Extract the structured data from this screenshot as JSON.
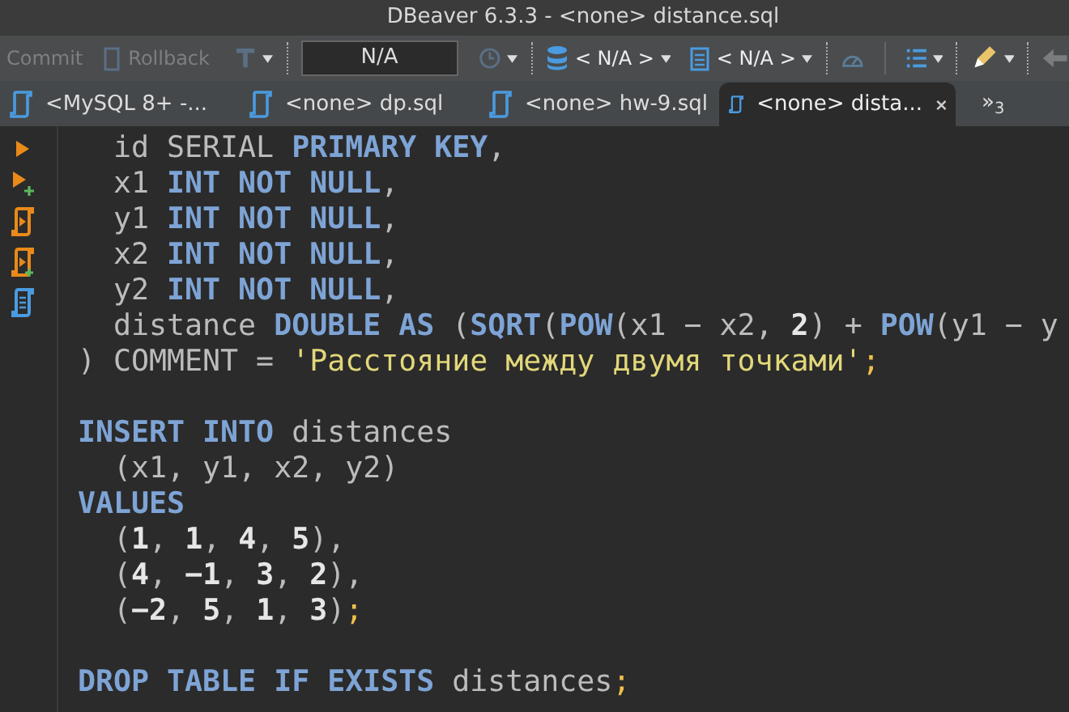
{
  "window": {
    "title": "DBeaver 6.3.3 - <none> distance.sql"
  },
  "toolbar": {
    "commit": {
      "label": "Commit",
      "disabled": true
    },
    "rollback": {
      "label": "Rollback",
      "disabled": true
    },
    "transaction_field": {
      "value": "N/A"
    },
    "datasource": {
      "label": "< N/A >"
    },
    "schema": {
      "label": "< N/A >"
    }
  },
  "tabs": [
    {
      "label": "<MySQL 8+ -...",
      "selected": false
    },
    {
      "label": "<none> dp.sql",
      "selected": false
    },
    {
      "label": "<none> hw-9.sql",
      "selected": false
    },
    {
      "label": "<none> dista...",
      "selected": true
    }
  ],
  "tab_overflow": "»$_{3}$",
  "editor": {
    "blocks": [
      [
        [
          {
            "kind": "plain",
            "text": "  id SERIAL "
          },
          {
            "kind": "kw",
            "text": "PRIMARY KEY"
          },
          {
            "kind": "plain",
            "text": ","
          }
        ],
        [
          {
            "kind": "plain",
            "text": "  x1 "
          },
          {
            "kind": "kw",
            "text": "INT NOT NULL"
          },
          {
            "kind": "plain",
            "text": ","
          }
        ],
        [
          {
            "kind": "plain",
            "text": "  y1 "
          },
          {
            "kind": "kw",
            "text": "INT NOT NULL"
          },
          {
            "kind": "plain",
            "text": ","
          }
        ],
        [
          {
            "kind": "plain",
            "text": "  x2 "
          },
          {
            "kind": "kw",
            "text": "INT NOT NULL"
          },
          {
            "kind": "plain",
            "text": ","
          }
        ],
        [
          {
            "kind": "plain",
            "text": "  y2 "
          },
          {
            "kind": "kw",
            "text": "INT NOT NULL"
          },
          {
            "kind": "plain",
            "text": ","
          }
        ],
        [
          {
            "kind": "plain",
            "text": "  distance "
          },
          {
            "kind": "kw",
            "text": "DOUBLE AS"
          },
          {
            "kind": "plain",
            "text": " ("
          },
          {
            "kind": "kw",
            "text": "SQRT"
          },
          {
            "kind": "plain",
            "text": "("
          },
          {
            "kind": "kw",
            "text": "POW"
          },
          {
            "kind": "plain",
            "text": "(x1 − x2, "
          },
          {
            "kind": "num",
            "text": "2"
          },
          {
            "kind": "plain",
            "text": ") + "
          },
          {
            "kind": "kw",
            "text": "POW"
          },
          {
            "kind": "plain",
            "text": "(y1 − y"
          }
        ],
        [
          {
            "kind": "plain",
            "text": ") COMMENT = "
          },
          {
            "kind": "str",
            "text": "'Расстояние между двумя точками'"
          },
          {
            "kind": "semi",
            "text": ";"
          }
        ]
      ],
      [
        [
          {
            "kind": "kw",
            "text": "INSERT INTO"
          },
          {
            "kind": "plain",
            "text": " distances"
          }
        ],
        [
          {
            "kind": "plain",
            "text": "  (x1, y1, x2, y2)"
          }
        ],
        [
          {
            "kind": "kw",
            "text": "VALUES"
          }
        ],
        [
          {
            "kind": "plain",
            "text": "  ("
          },
          {
            "kind": "num",
            "text": "1"
          },
          {
            "kind": "plain",
            "text": ", "
          },
          {
            "kind": "num",
            "text": "1"
          },
          {
            "kind": "plain",
            "text": ", "
          },
          {
            "kind": "num",
            "text": "4"
          },
          {
            "kind": "plain",
            "text": ", "
          },
          {
            "kind": "num",
            "text": "5"
          },
          {
            "kind": "plain",
            "text": "),"
          }
        ],
        [
          {
            "kind": "plain",
            "text": "  ("
          },
          {
            "kind": "num",
            "text": "4"
          },
          {
            "kind": "plain",
            "text": ", "
          },
          {
            "kind": "num",
            "text": "−1"
          },
          {
            "kind": "plain",
            "text": ", "
          },
          {
            "kind": "num",
            "text": "3"
          },
          {
            "kind": "plain",
            "text": ", "
          },
          {
            "kind": "num",
            "text": "2"
          },
          {
            "kind": "plain",
            "text": "),"
          }
        ],
        [
          {
            "kind": "plain",
            "text": "  ("
          },
          {
            "kind": "num",
            "text": "−2"
          },
          {
            "kind": "plain",
            "text": ", "
          },
          {
            "kind": "num",
            "text": "5"
          },
          {
            "kind": "plain",
            "text": ", "
          },
          {
            "kind": "num",
            "text": "1"
          },
          {
            "kind": "plain",
            "text": ", "
          },
          {
            "kind": "num",
            "text": "3"
          },
          {
            "kind": "plain",
            "text": ")"
          },
          {
            "kind": "semi",
            "text": ";"
          }
        ]
      ],
      [
        [
          {
            "kind": "kw",
            "text": "DROP TABLE IF EXISTS"
          },
          {
            "kind": "plain",
            "text": " distances"
          },
          {
            "kind": "semi",
            "text": ";"
          }
        ]
      ]
    ]
  }
}
